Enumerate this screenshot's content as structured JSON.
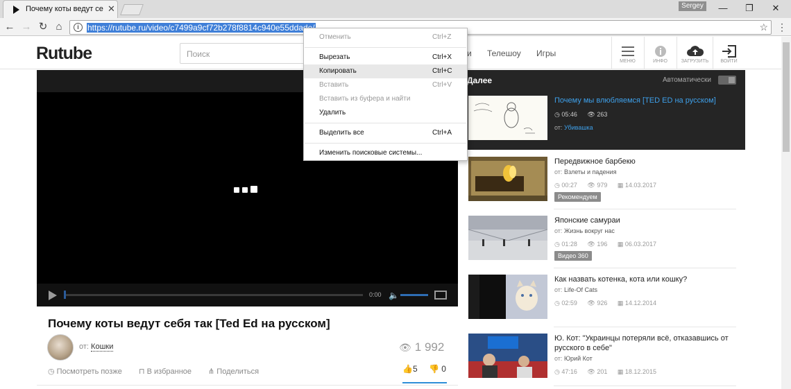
{
  "browser": {
    "tab_title": "Почему коты ведут себя так [Ted Ed на русском] - Rutube",
    "tab_close": "✕",
    "user": "Sergey",
    "url": "https://rutube.ru/video/c7499a9cf72b278f8814c940e55ddade/",
    "win_min": "—",
    "win_max": "❐",
    "win_close": "✕"
  },
  "site": {
    "logo": "Rutube",
    "search_placeholder": "Поиск",
    "nav": [
      "и",
      "Телешоу",
      "Игры"
    ],
    "header_buttons": [
      {
        "label": "МЕНЮ",
        "icon": "menu-icon"
      },
      {
        "label": "ИНФО",
        "icon": "info-icon"
      },
      {
        "label": "ЗАГРУЗИТЬ",
        "icon": "upload-cloud-icon"
      },
      {
        "label": "ВОЙТИ",
        "icon": "login-icon"
      }
    ]
  },
  "player": {
    "time": "0:00"
  },
  "video": {
    "title": "Почему коты ведут себя так [Ted Ed на русском]",
    "from_prefix": "от:",
    "channel": "Кошки",
    "views": "1 992",
    "actions": [
      "Посмотреть позже",
      "В избранное",
      "Поделиться"
    ],
    "likes": "5",
    "dislikes": "0"
  },
  "sidebar": {
    "next_label": "Далее",
    "auto_label": "Автоматически",
    "items": [
      {
        "title": "Почему мы влюбляемся [TED ED на русском]",
        "from": "Убивашка",
        "duration": "05:46",
        "views": "263",
        "date": "",
        "badge": ""
      },
      {
        "title": "Передвижное барбекю",
        "from": "Взлеты и падения",
        "duration": "00:27",
        "views": "979",
        "date": "14.03.2017",
        "badge": "Рекомендуем"
      },
      {
        "title": "Японские самураи",
        "from": "Жизнь вокруг нас",
        "duration": "01:28",
        "views": "196",
        "date": "06.03.2017",
        "badge": "Видео 360"
      },
      {
        "title": "Как назвать котенка, кота или кошку?",
        "from": "Life-Of Cats",
        "duration": "02:59",
        "views": "926",
        "date": "14.12.2014",
        "badge": ""
      },
      {
        "title": "Ю. Кот: \"Украинцы потеряли всё, отказавшись от русского в себе\"",
        "from": "Юрий Кот",
        "duration": "47:16",
        "views": "201",
        "date": "18.12.2015",
        "badge": ""
      }
    ]
  },
  "context_menu": {
    "items": [
      {
        "label": "Отменить",
        "shortcut": "Ctrl+Z",
        "enabled": false
      },
      {
        "label": "Вырезать",
        "shortcut": "Ctrl+X",
        "enabled": true
      },
      {
        "label": "Копировать",
        "shortcut": "Ctrl+C",
        "enabled": true
      },
      {
        "label": "Вставить",
        "shortcut": "Ctrl+V",
        "enabled": false
      },
      {
        "label": "Вставить из буфера и найти",
        "shortcut": "",
        "enabled": false
      },
      {
        "label": "Удалить",
        "shortcut": "",
        "enabled": true
      },
      {
        "label": "Выделить все",
        "shortcut": "Ctrl+A",
        "enabled": true
      },
      {
        "label": "Изменить поисковые системы...",
        "shortcut": "",
        "enabled": true
      }
    ]
  },
  "colors": {
    "accent": "#3ea0ea",
    "url_highlight": "#3f7fd8",
    "sidebar_dark": "#252525"
  }
}
